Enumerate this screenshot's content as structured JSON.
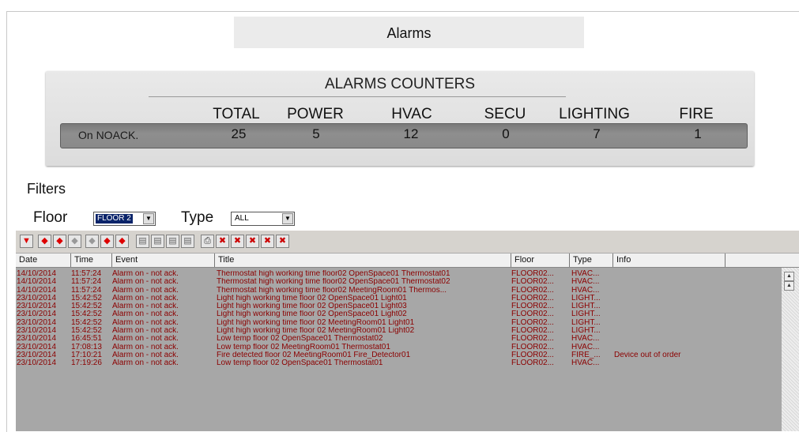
{
  "page": {
    "title": "Alarms"
  },
  "counters": {
    "title": "ALARMS COUNTERS",
    "columns": [
      "TOTAL",
      "POWER",
      "HVAC",
      "SECU",
      "LIGHTING",
      "FIRE"
    ],
    "row_label": "On NOACK.",
    "values": [
      "25",
      "5",
      "12",
      "0",
      "7",
      "1"
    ]
  },
  "filters": {
    "label": "Filters",
    "floor_label": "Floor",
    "floor_value": "FLOOR 2",
    "type_label": "Type",
    "type_value": "ALL"
  },
  "toolbar": {
    "icons": [
      "filter-dropdown-icon",
      "alarm-bell-icon",
      "alarm-ack-icon",
      "alarm-clear-icon",
      "alarm-info-icon",
      "alarm-notify-icon",
      "alarm-history-icon",
      "chart-icon",
      "chart-add-icon",
      "chart-remove-icon",
      "chart-export-icon",
      "print-icon",
      "delete-selected-icon",
      "delete-all-icon",
      "close-selected-icon",
      "close-all-icon",
      "close-icon"
    ]
  },
  "table": {
    "headers": [
      "Date",
      "Time",
      "Event",
      "Title",
      "Floor",
      "Type",
      "Info"
    ],
    "rows": [
      [
        "14/10/2014",
        "11:57:24",
        "Alarm on - not ack.",
        "Thermostat high working time floor02 OpenSpace01 Thermostat01",
        "FLOOR02...",
        "HVAC...",
        ""
      ],
      [
        "14/10/2014",
        "11:57:24",
        "Alarm on - not ack.",
        "Thermostat high working time floor02 OpenSpace01 Thermostat02",
        "FLOOR02...",
        "HVAC...",
        ""
      ],
      [
        "14/10/2014",
        "11:57:24",
        "Alarm on - not ack.",
        "Thermostat high working time floor02 MeetingRoom01 Thermos...",
        "FLOOR02...",
        "HVAC...",
        ""
      ],
      [
        "23/10/2014",
        "15:42:52",
        "Alarm on - not ack.",
        "Light high working time floor 02 OpenSpace01 Light01",
        "FLOOR02...",
        "LIGHT...",
        ""
      ],
      [
        "23/10/2014",
        "15:42:52",
        "Alarm on - not ack.",
        "Light high working time floor 02 OpenSpace01 Light03",
        "FLOOR02...",
        "LIGHT...",
        ""
      ],
      [
        "23/10/2014",
        "15:42:52",
        "Alarm on - not ack.",
        "Light high working time floor 02 OpenSpace01 Light02",
        "FLOOR02...",
        "LIGHT...",
        ""
      ],
      [
        "23/10/2014",
        "15:42:52",
        "Alarm on - not ack.",
        "Light high working time floor 02 MeetingRoom01 Light01",
        "FLOOR02...",
        "LIGHT...",
        ""
      ],
      [
        "23/10/2014",
        "15:42:52",
        "Alarm on - not ack.",
        "Light high working time floor 02 MeetingRoom01 Light02",
        "FLOOR02...",
        "LIGHT...",
        ""
      ],
      [
        "23/10/2014",
        "16:45:51",
        "Alarm on - not ack.",
        "Low temp floor 02 OpenSpace01 Thermostat02",
        "FLOOR02...",
        "HVAC...",
        ""
      ],
      [
        "23/10/2014",
        "17:08:13",
        "Alarm on - not ack.",
        "Low temp floor 02 MeetingRoom01 Thermostat01",
        "FLOOR02...",
        "HVAC...",
        ""
      ],
      [
        "23/10/2014",
        "17:10:21",
        "Alarm on - not ack.",
        "Fire detected floor 02 MeetingRoom01 Fire_Detector01",
        "FLOOR02...",
        "FIRE_...",
        "Device out of order"
      ],
      [
        "23/10/2014",
        "17:19:26",
        "Alarm on - not ack.",
        "Low temp floor 02 OpenSpace01 Thermostat01",
        "FLOOR02...",
        "HVAC...",
        ""
      ]
    ]
  },
  "colors": {
    "alarm_text": "#8b0000",
    "grid_bg": "#a7a7a7",
    "counter_bar": "#8a8a8a"
  }
}
